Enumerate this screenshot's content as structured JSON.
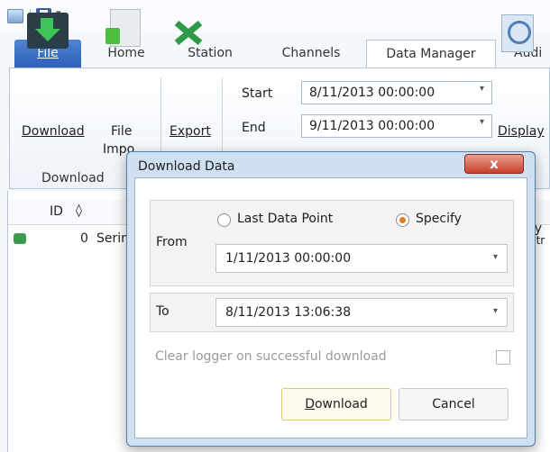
{
  "tabs": {
    "file": "File",
    "home": "Home",
    "station": "Station",
    "channels": "Channels",
    "data_manager": "Data Manager",
    "audit": "Audi"
  },
  "ribbon": {
    "download_label": "Download",
    "file_import_label_1": "File",
    "file_import_label_2": "Impo",
    "export_label": "Export",
    "start_label": "Start",
    "start_value": "8/11/2013 00:00:00",
    "end_label": "End",
    "end_value": "9/11/2013 00:00:00",
    "display_label": "Display",
    "group_download": "Download"
  },
  "grid": {
    "col_id": "ID",
    "sort_glyph": "◊",
    "row_id": "0",
    "row_name": "Serin",
    "right_text_1": "ry",
    "right_text_2": "ntr"
  },
  "dialog": {
    "title": "Download Data",
    "close": "x",
    "last_data_point": "Last Data Point",
    "specify": "Specify",
    "from_label": "From",
    "from_value": "1/11/2013 00:00:00",
    "to_label": "To",
    "to_value": "8/11/2013 13:06:38",
    "clear_logger": "Clear logger on successful download",
    "download_btn_prefix": "D",
    "download_btn_rest": "ownload",
    "cancel_btn": "Cancel"
  },
  "colors": {
    "accent_file_tab": "#2c5fb6",
    "radio_selected": "#e07e1e",
    "close_button": "#c8412b"
  },
  "icons": [
    "app-icon",
    "save-icon",
    "download-icon",
    "file-import-icon",
    "excel-export-icon",
    "display-icon",
    "close-icon"
  ]
}
